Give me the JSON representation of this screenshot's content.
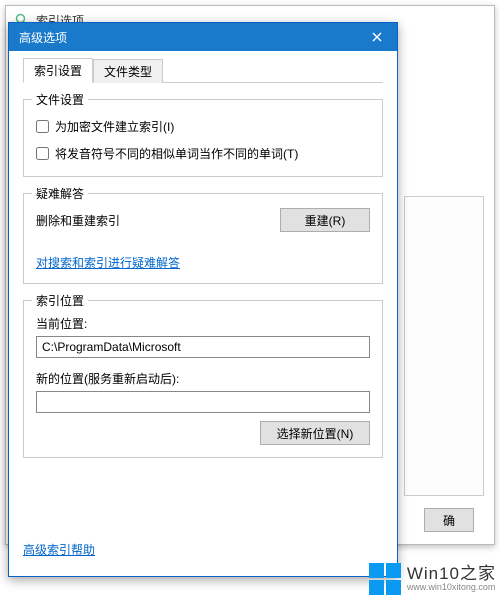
{
  "parent": {
    "title": "索引选项",
    "ok": "确"
  },
  "dialog": {
    "title": "高级选项",
    "tabs": {
      "index_settings": "索引设置",
      "file_types": "文件类型"
    },
    "file_settings": {
      "legend": "文件设置",
      "encrypt": "为加密文件建立索引(I)",
      "diacritics": "将发音符号不同的相似单词当作不同的单词(T)"
    },
    "troubleshoot": {
      "legend": "疑难解答",
      "desc": "删除和重建索引",
      "rebuild": "重建(R)",
      "link": "对搜索和索引进行疑难解答"
    },
    "location": {
      "legend": "索引位置",
      "current_label": "当前位置:",
      "current_value": "C:\\ProgramData\\Microsoft",
      "new_label": "新的位置(服务重新启动后):",
      "new_value": "",
      "select_new": "选择新位置(N)"
    },
    "help_link": "高级索引帮助"
  },
  "watermark": {
    "text": "Win10之家",
    "url": "www.win10xitong.com"
  }
}
